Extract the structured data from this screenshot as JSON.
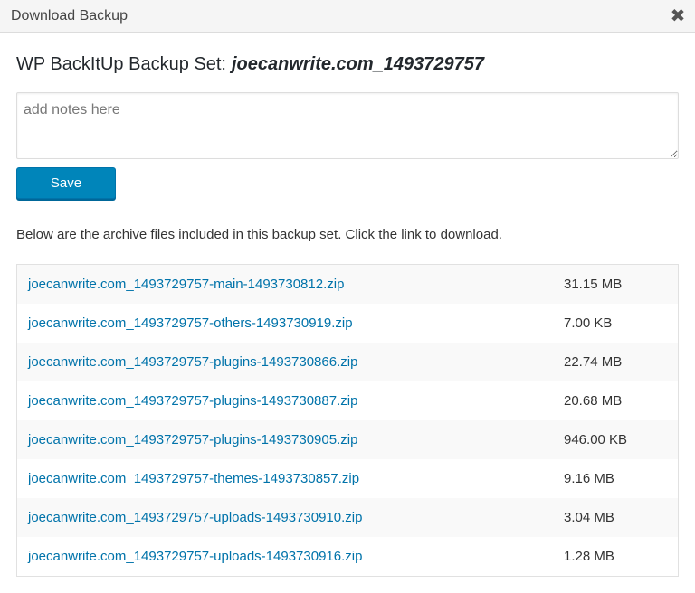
{
  "dialog": {
    "title": "Download Backup",
    "close_glyph": "✖"
  },
  "heading": {
    "prefix": "WP BackItUp Backup Set:",
    "set_name": "joecanwrite.com_1493729757"
  },
  "notes": {
    "value": "",
    "placeholder": "add notes here"
  },
  "save_button": {
    "label": "Save"
  },
  "intro_text": "Below are the archive files included in this backup set. Click the link to download.",
  "files": [
    {
      "name": "joecanwrite.com_1493729757-main-1493730812.zip",
      "size": "31.15 MB"
    },
    {
      "name": "joecanwrite.com_1493729757-others-1493730919.zip",
      "size": "7.00 KB"
    },
    {
      "name": "joecanwrite.com_1493729757-plugins-1493730866.zip",
      "size": "22.74 MB"
    },
    {
      "name": "joecanwrite.com_1493729757-plugins-1493730887.zip",
      "size": "20.68 MB"
    },
    {
      "name": "joecanwrite.com_1493729757-plugins-1493730905.zip",
      "size": "946.00 KB"
    },
    {
      "name": "joecanwrite.com_1493729757-themes-1493730857.zip",
      "size": "9.16 MB"
    },
    {
      "name": "joecanwrite.com_1493729757-uploads-1493730910.zip",
      "size": "3.04 MB"
    },
    {
      "name": "joecanwrite.com_1493729757-uploads-1493730916.zip",
      "size": "1.28 MB"
    }
  ],
  "colors": {
    "link": "#0073aa",
    "primary_button": "#0085ba"
  }
}
